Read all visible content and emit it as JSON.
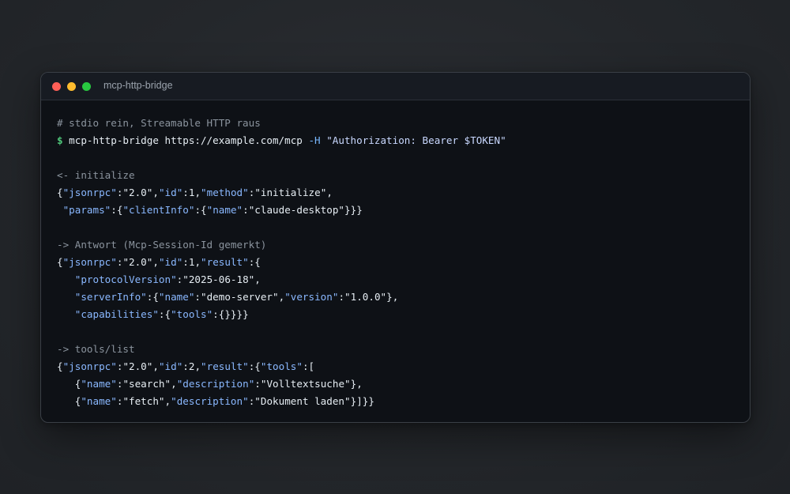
{
  "window": {
    "title": "mcp-http-bridge",
    "controls": {
      "close_color": "#ff5f57",
      "minimize_color": "#febc2e",
      "maximize_color": "#28c840"
    }
  },
  "terminal": {
    "lines": [
      [
        {
          "t": "# stdio rein, Streamable HTTP raus",
          "c": "comment"
        }
      ],
      [
        {
          "t": "$ ",
          "c": "prompt"
        },
        {
          "t": "mcp-http-bridge https://example.com/mcp ",
          "c": "cmd"
        },
        {
          "t": "-H ",
          "c": "flag"
        },
        {
          "t": "\"Authorization: Bearer $TOKEN\"",
          "c": "str"
        }
      ],
      [],
      [
        {
          "t": "<- initialize",
          "c": "comment"
        }
      ],
      [
        {
          "t": "{",
          "c": "punct"
        },
        {
          "t": "\"jsonrpc\"",
          "c": "key"
        },
        {
          "t": ":",
          "c": "punct"
        },
        {
          "t": "\"2.0\"",
          "c": "val"
        },
        {
          "t": ",",
          "c": "punct"
        },
        {
          "t": "\"id\"",
          "c": "key"
        },
        {
          "t": ":1,",
          "c": "punct"
        },
        {
          "t": "\"method\"",
          "c": "key"
        },
        {
          "t": ":",
          "c": "punct"
        },
        {
          "t": "\"initialize\"",
          "c": "val"
        },
        {
          "t": ",",
          "c": "punct"
        }
      ],
      [
        {
          "t": " ",
          "c": "punct"
        },
        {
          "t": "\"params\"",
          "c": "key"
        },
        {
          "t": ":{",
          "c": "punct"
        },
        {
          "t": "\"clientInfo\"",
          "c": "key"
        },
        {
          "t": ":{",
          "c": "punct"
        },
        {
          "t": "\"name\"",
          "c": "key"
        },
        {
          "t": ":",
          "c": "punct"
        },
        {
          "t": "\"claude-desktop\"",
          "c": "val"
        },
        {
          "t": "}}}",
          "c": "punct"
        }
      ],
      [],
      [
        {
          "t": "-> Antwort (Mcp-Session-Id gemerkt)",
          "c": "comment"
        }
      ],
      [
        {
          "t": "{",
          "c": "punct"
        },
        {
          "t": "\"jsonrpc\"",
          "c": "key"
        },
        {
          "t": ":",
          "c": "punct"
        },
        {
          "t": "\"2.0\"",
          "c": "val"
        },
        {
          "t": ",",
          "c": "punct"
        },
        {
          "t": "\"id\"",
          "c": "key"
        },
        {
          "t": ":1,",
          "c": "punct"
        },
        {
          "t": "\"result\"",
          "c": "key"
        },
        {
          "t": ":{",
          "c": "punct"
        }
      ],
      [
        {
          "t": "   ",
          "c": "punct"
        },
        {
          "t": "\"protocolVersion\"",
          "c": "key"
        },
        {
          "t": ":",
          "c": "punct"
        },
        {
          "t": "\"2025-06-18\"",
          "c": "val"
        },
        {
          "t": ",",
          "c": "punct"
        }
      ],
      [
        {
          "t": "   ",
          "c": "punct"
        },
        {
          "t": "\"serverInfo\"",
          "c": "key"
        },
        {
          "t": ":{",
          "c": "punct"
        },
        {
          "t": "\"name\"",
          "c": "key"
        },
        {
          "t": ":",
          "c": "punct"
        },
        {
          "t": "\"demo-server\"",
          "c": "val"
        },
        {
          "t": ",",
          "c": "punct"
        },
        {
          "t": "\"version\"",
          "c": "key"
        },
        {
          "t": ":",
          "c": "punct"
        },
        {
          "t": "\"1.0.0\"",
          "c": "val"
        },
        {
          "t": "},",
          "c": "punct"
        }
      ],
      [
        {
          "t": "   ",
          "c": "punct"
        },
        {
          "t": "\"capabilities\"",
          "c": "key"
        },
        {
          "t": ":{",
          "c": "punct"
        },
        {
          "t": "\"tools\"",
          "c": "key"
        },
        {
          "t": ":{}}}}",
          "c": "punct"
        }
      ],
      [],
      [
        {
          "t": "-> tools/list",
          "c": "comment"
        }
      ],
      [
        {
          "t": "{",
          "c": "punct"
        },
        {
          "t": "\"jsonrpc\"",
          "c": "key"
        },
        {
          "t": ":",
          "c": "punct"
        },
        {
          "t": "\"2.0\"",
          "c": "val"
        },
        {
          "t": ",",
          "c": "punct"
        },
        {
          "t": "\"id\"",
          "c": "key"
        },
        {
          "t": ":2,",
          "c": "punct"
        },
        {
          "t": "\"result\"",
          "c": "key"
        },
        {
          "t": ":{",
          "c": "punct"
        },
        {
          "t": "\"tools\"",
          "c": "key"
        },
        {
          "t": ":[",
          "c": "punct"
        }
      ],
      [
        {
          "t": "   {",
          "c": "punct"
        },
        {
          "t": "\"name\"",
          "c": "key"
        },
        {
          "t": ":",
          "c": "punct"
        },
        {
          "t": "\"search\"",
          "c": "val"
        },
        {
          "t": ",",
          "c": "punct"
        },
        {
          "t": "\"description\"",
          "c": "key"
        },
        {
          "t": ":",
          "c": "punct"
        },
        {
          "t": "\"Volltextsuche\"",
          "c": "val"
        },
        {
          "t": "},",
          "c": "punct"
        }
      ],
      [
        {
          "t": "   {",
          "c": "punct"
        },
        {
          "t": "\"name\"",
          "c": "key"
        },
        {
          "t": ":",
          "c": "punct"
        },
        {
          "t": "\"fetch\"",
          "c": "val"
        },
        {
          "t": ",",
          "c": "punct"
        },
        {
          "t": "\"description\"",
          "c": "key"
        },
        {
          "t": ":",
          "c": "punct"
        },
        {
          "t": "\"Dokument laden\"",
          "c": "val"
        },
        {
          "t": "}]}}",
          "c": "punct"
        }
      ]
    ]
  }
}
